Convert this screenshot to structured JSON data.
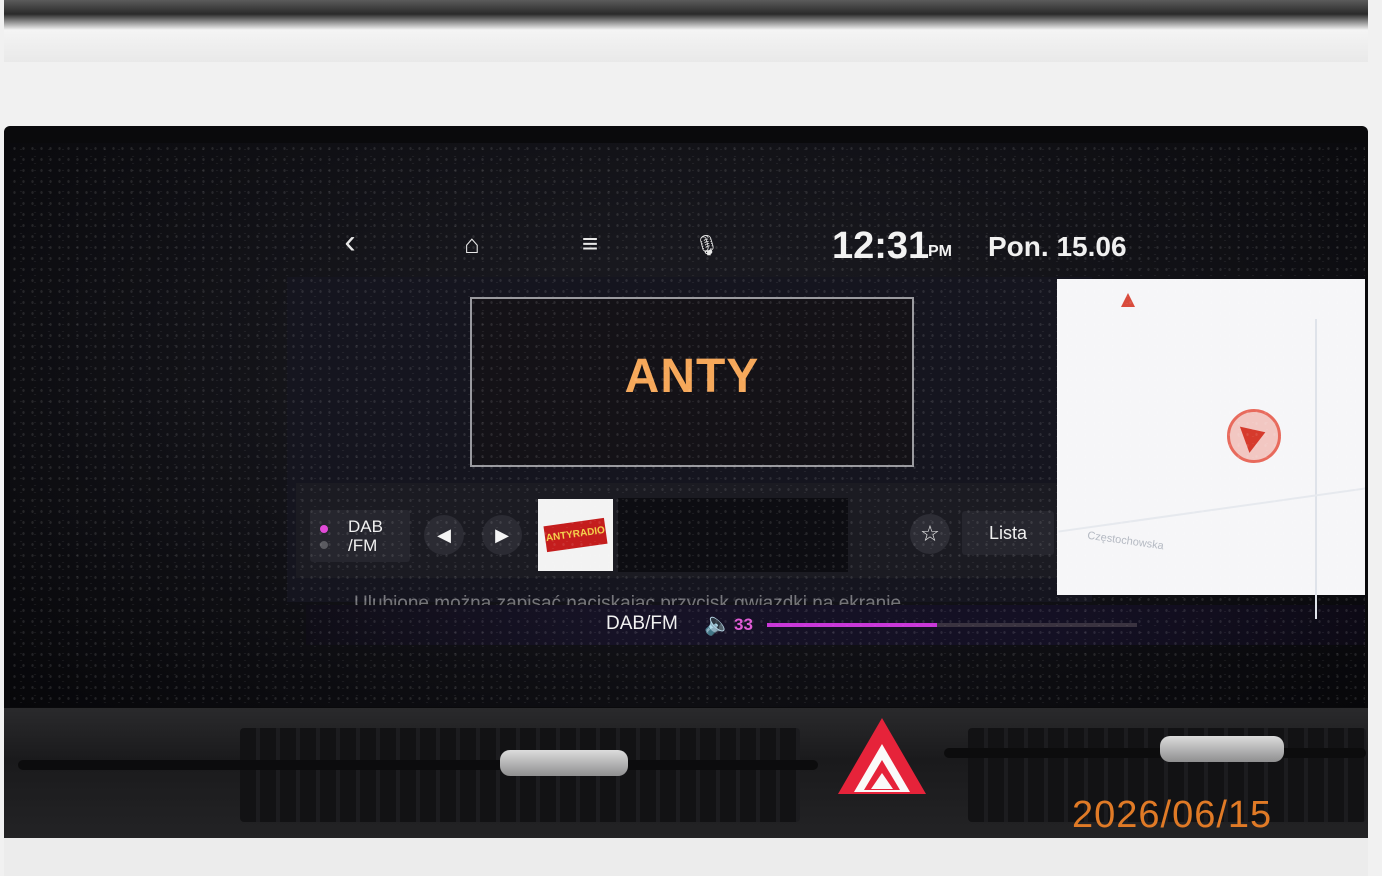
{
  "status_bar": {
    "back_icon": "‹",
    "home_icon": "⌂",
    "menu_icon": "≡",
    "mic_icon": "🎙",
    "time": "12:31",
    "ampm": "PM",
    "date": "Pon. 15.06"
  },
  "radio": {
    "station_name": "ANTY",
    "source_toggle": {
      "line1": "DAB",
      "line2": "/FM"
    },
    "prev_icon": "◀",
    "next_icon": "▶",
    "logo_text": "ANTYRADIO",
    "favorite_icon": "☆",
    "list_label": "Lista",
    "hint_text": "Ulubione można zapisać naciskając przycisk gwiazdki na ekranie"
  },
  "bottom_bar": {
    "source_label": "DAB/FM",
    "volume_icon": "🔈",
    "volume_value": "33",
    "volume_level_percent": 46
  },
  "map": {
    "street_label": "Częstochowska"
  },
  "photo_timestamp": "2026/06/15",
  "colors": {
    "station_orange": "#f6a85a",
    "volume_magenta": "#c938d8",
    "hazard_red": "#e6233a",
    "timestamp_orange": "#e07a26"
  }
}
